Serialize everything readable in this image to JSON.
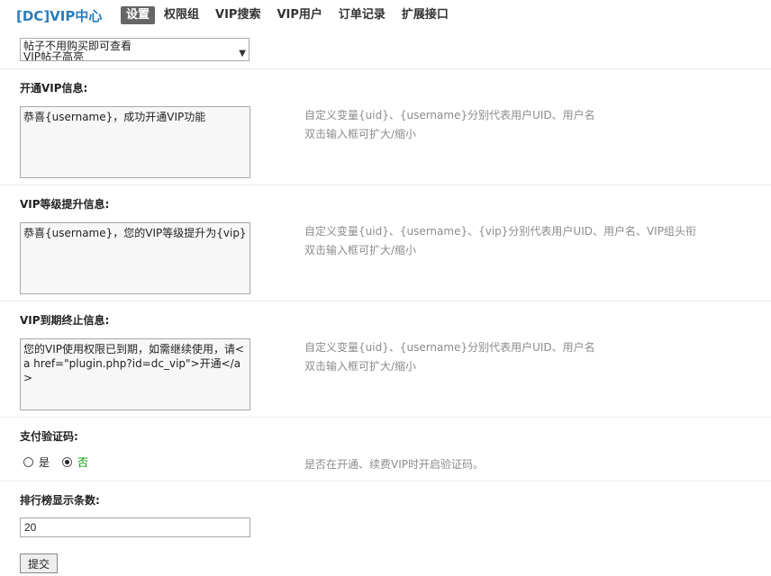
{
  "app": {
    "title": "[DC]VIP中心"
  },
  "nav": {
    "items": [
      "设置",
      "权限组",
      "VIP搜索",
      "VIP用户",
      "订单记录",
      "扩展接口"
    ]
  },
  "top_select": {
    "visible_options": [
      "帖子不用购买即可查看",
      "VIP帖子高亮"
    ]
  },
  "sections": {
    "open_vip": {
      "label": "开通VIP信息:",
      "value": "恭喜{username}，成功开通VIP功能",
      "tip_line1": "自定义变量{uid}、{username}分别代表用户UID、用户名",
      "tip_line2": "双击输入框可扩大/缩小"
    },
    "level_up": {
      "label": "VIP等级提升信息:",
      "value": "恭喜{username}，您的VIP等级提升为{vip}",
      "tip_line1": "自定义变量{uid}、{username}、{vip}分别代表用户UID、用户名、VIP组头衔",
      "tip_line2": "双击输入框可扩大/缩小"
    },
    "expire": {
      "label": "VIP到期终止信息:",
      "value": "您的VIP使用权限已到期，如需继续使用，请<a href=\"plugin.php?id=dc_vip\">开通</a>",
      "tip_line1": "自定义变量{uid}、{username}分别代表用户UID、用户名",
      "tip_line2": "双击输入框可扩大/缩小"
    },
    "pay_captcha": {
      "label": "支付验证码:",
      "options": [
        "是",
        "否"
      ],
      "selected": "否",
      "tip": "是否在开通、续费VIP时开启验证码。"
    },
    "rank_count": {
      "label": "排行榜显示条数:",
      "value": "20"
    }
  },
  "submit": {
    "label": "提交"
  },
  "colors": {
    "title": "#2b7dbc",
    "active_tab_bg": "#666666",
    "tip": "#8c8c8c",
    "selected_radio_label": "#009900"
  }
}
